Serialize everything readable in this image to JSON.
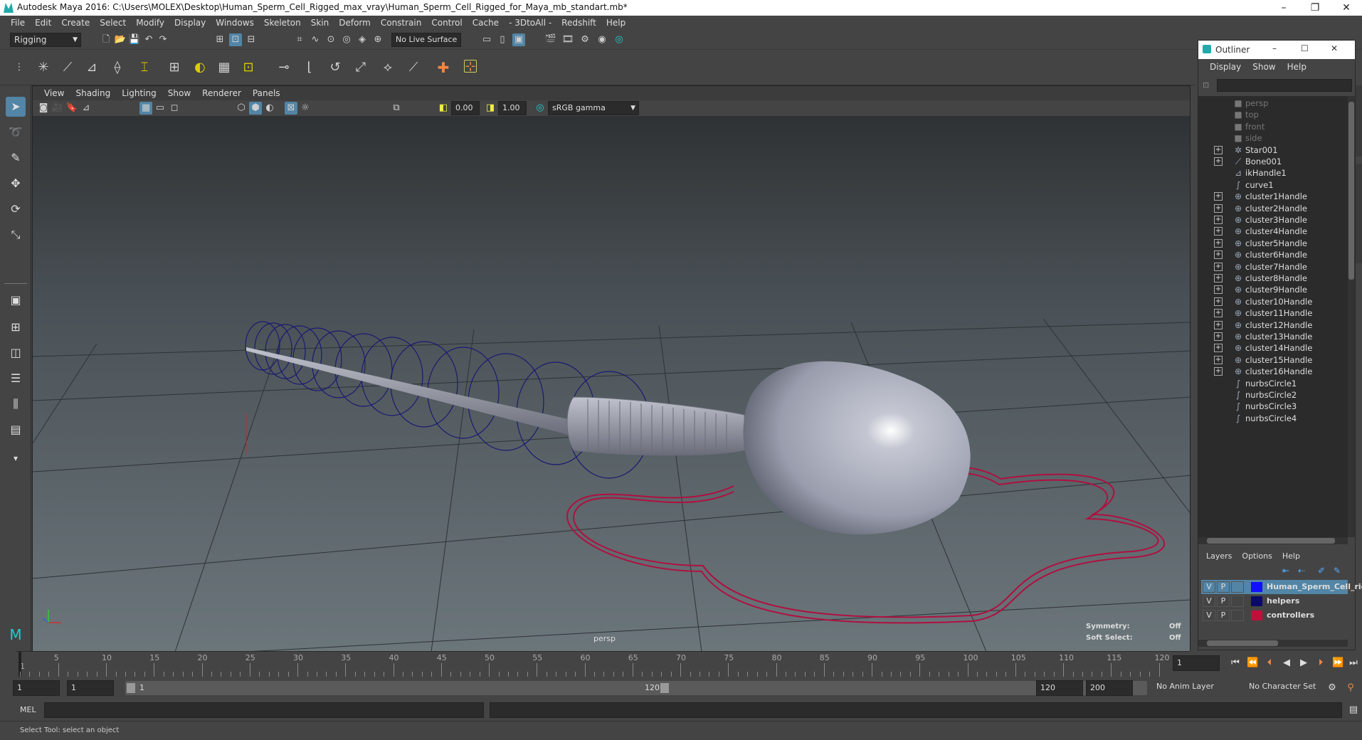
{
  "window": {
    "title": "Autodesk Maya 2016: C:\\Users\\MOLEX\\Desktop\\Human_Sperm_Cell_Rigged_max_vray\\Human_Sperm_Cell_Rigged_for_Maya_mb_standart.mb*"
  },
  "menubar": [
    "File",
    "Edit",
    "Create",
    "Select",
    "Modify",
    "Display",
    "Windows",
    "Skeleton",
    "Skin",
    "Deform",
    "Constrain",
    "Control",
    "Cache",
    "- 3DtoAll -",
    "Redshift",
    "Help"
  ],
  "shelf": {
    "mode": "Rigging",
    "live_surface": "No Live Surface"
  },
  "viewport": {
    "menu": [
      "View",
      "Shading",
      "Lighting",
      "Show",
      "Renderer",
      "Panels"
    ],
    "exposure": "0.00",
    "gamma": "1.00",
    "color_space": "sRGB gamma",
    "camera_label": "persp",
    "symmetry_label": "Symmetry:",
    "symmetry_value": "Off",
    "soft_select_label": "Soft Select:",
    "soft_select_value": "Off"
  },
  "outliner": {
    "title": "Outliner",
    "menu": [
      "Display",
      "Show",
      "Help"
    ],
    "items": [
      {
        "label": "persp",
        "icon": "camera-icon",
        "expand": false,
        "dim": true
      },
      {
        "label": "top",
        "icon": "camera-icon",
        "expand": false,
        "dim": true
      },
      {
        "label": "front",
        "icon": "camera-icon",
        "expand": false,
        "dim": true
      },
      {
        "label": "side",
        "icon": "camera-icon",
        "expand": false,
        "dim": true
      },
      {
        "label": "Star001",
        "icon": "group-icon",
        "expand": true,
        "dim": false
      },
      {
        "label": "Bone001",
        "icon": "joint-icon",
        "expand": true,
        "dim": false
      },
      {
        "label": "ikHandle1",
        "icon": "ik-handle-icon",
        "expand": false,
        "dim": false
      },
      {
        "label": "curve1",
        "icon": "curve-icon",
        "expand": false,
        "dim": false
      },
      {
        "label": "cluster1Handle",
        "icon": "cluster-icon",
        "expand": true,
        "dim": false
      },
      {
        "label": "cluster2Handle",
        "icon": "cluster-icon",
        "expand": true,
        "dim": false
      },
      {
        "label": "cluster3Handle",
        "icon": "cluster-icon",
        "expand": true,
        "dim": false
      },
      {
        "label": "cluster4Handle",
        "icon": "cluster-icon",
        "expand": true,
        "dim": false
      },
      {
        "label": "cluster5Handle",
        "icon": "cluster-icon",
        "expand": true,
        "dim": false
      },
      {
        "label": "cluster6Handle",
        "icon": "cluster-icon",
        "expand": true,
        "dim": false
      },
      {
        "label": "cluster7Handle",
        "icon": "cluster-icon",
        "expand": true,
        "dim": false
      },
      {
        "label": "cluster8Handle",
        "icon": "cluster-icon",
        "expand": true,
        "dim": false
      },
      {
        "label": "cluster9Handle",
        "icon": "cluster-icon",
        "expand": true,
        "dim": false
      },
      {
        "label": "cluster10Handle",
        "icon": "cluster-icon",
        "expand": true,
        "dim": false
      },
      {
        "label": "cluster11Handle",
        "icon": "cluster-icon",
        "expand": true,
        "dim": false
      },
      {
        "label": "cluster12Handle",
        "icon": "cluster-icon",
        "expand": true,
        "dim": false
      },
      {
        "label": "cluster13Handle",
        "icon": "cluster-icon",
        "expand": true,
        "dim": false
      },
      {
        "label": "cluster14Handle",
        "icon": "cluster-icon",
        "expand": true,
        "dim": false
      },
      {
        "label": "cluster15Handle",
        "icon": "cluster-icon",
        "expand": true,
        "dim": false
      },
      {
        "label": "cluster16Handle",
        "icon": "cluster-icon",
        "expand": true,
        "dim": false
      },
      {
        "label": "nurbsCircle1",
        "icon": "curve-icon",
        "expand": false,
        "dim": false
      },
      {
        "label": "nurbsCircle2",
        "icon": "curve-icon",
        "expand": false,
        "dim": false
      },
      {
        "label": "nurbsCircle3",
        "icon": "curve-icon",
        "expand": false,
        "dim": false
      },
      {
        "label": "nurbsCircle4",
        "icon": "curve-icon",
        "expand": false,
        "dim": false
      }
    ]
  },
  "layers": {
    "menu": [
      "Layers",
      "Options",
      "Help"
    ],
    "rows": [
      {
        "v": "V",
        "p": "P",
        "name": "Human_Sperm_Cell_rig",
        "color": "#1010ff",
        "selected": true
      },
      {
        "v": "V",
        "p": "P",
        "name": "helpers",
        "color": "#0a0a6a",
        "selected": false
      },
      {
        "v": "V",
        "p": "P",
        "name": "controllers",
        "color": "#c0103a",
        "selected": false
      }
    ]
  },
  "timeline": {
    "ticks": [
      5,
      10,
      15,
      20,
      25,
      30,
      35,
      40,
      45,
      50,
      55,
      60,
      65,
      70,
      75,
      80,
      85,
      90,
      95,
      100,
      105,
      110,
      115,
      120
    ],
    "start_label": "1",
    "current_frame": "1"
  },
  "range": {
    "start": "1",
    "playback_start": "1",
    "slider_start": "1",
    "slider_end": "120",
    "playback_end": "120",
    "end": "200",
    "anim_layer": "No Anim Layer",
    "character_set": "No Character Set"
  },
  "cmdline": {
    "label": "MEL"
  },
  "helpline": {
    "text": "Select Tool: select an object"
  },
  "colors": {
    "accent": "#5285a6",
    "selection_curve": "#c0103a",
    "cluster_curve": "#1a1a80"
  }
}
